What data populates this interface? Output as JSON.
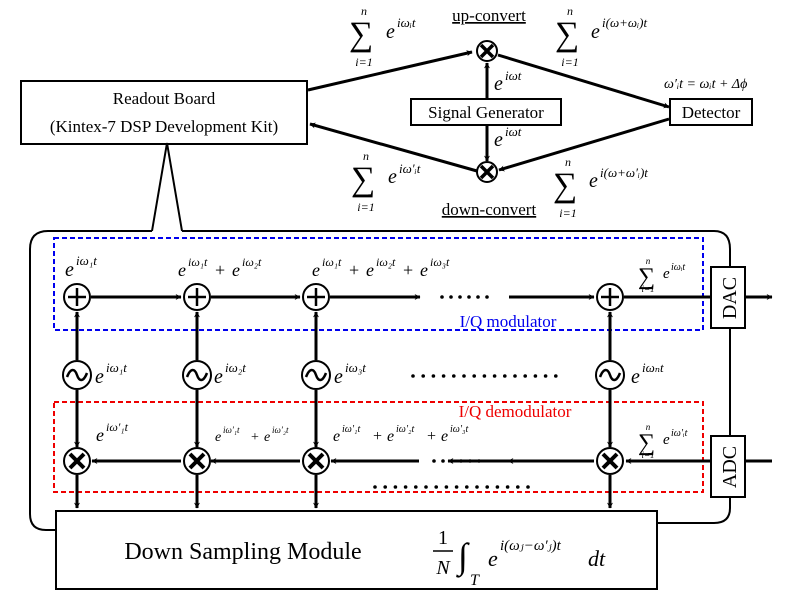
{
  "colors": {
    "line": "#000000",
    "modulator_border": "#0000ee",
    "demodulator_border": "#ee0000",
    "background": "#ffffff"
  },
  "readout_board": {
    "line1": "Readout Board",
    "line2": "(Kintex-7 DSP Development Kit)"
  },
  "signal_generator": {
    "label": "Signal Generator"
  },
  "detector": {
    "label": "Detector"
  },
  "up_convert": {
    "label": "up-convert",
    "input_sum": {
      "upper": "n",
      "lower": "i=1",
      "term": "e",
      "exp": "iωᵢt"
    },
    "carrier": {
      "base": "e",
      "exp": "iωt"
    },
    "output_sum": {
      "upper": "n",
      "lower": "i=1",
      "term": "e",
      "exp": "i(ω+ωᵢ)t"
    }
  },
  "down_convert": {
    "label": "down-convert",
    "input_sum": {
      "upper": "n",
      "lower": "i=1",
      "term": "e",
      "exp": "i(ω+ω′ᵢ)t"
    },
    "carrier": {
      "base": "e",
      "exp": "iωt"
    },
    "output_sum": {
      "upper": "n",
      "lower": "i=1",
      "term": "e",
      "exp": "iω′ᵢt"
    }
  },
  "phase_relation": "ω′ᵢt = ωᵢt + Δϕ",
  "modulator": {
    "label": "I/Q modulator",
    "adder_labels": [
      {
        "base": "e",
        "exp": "iω₁t"
      },
      {
        "text": "e^{iω₁t} + e^{iω₂t}",
        "parts": [
          {
            "base": "e",
            "exp": "iω₁t"
          },
          {
            "base": "e",
            "exp": "iω₂t"
          }
        ]
      },
      {
        "text": "e^{iω₁t} + e^{iω₂t} + e^{iω₃t}",
        "parts": [
          {
            "base": "e",
            "exp": "iω₁t"
          },
          {
            "base": "e",
            "exp": "iω₂t"
          },
          {
            "base": "e",
            "exp": "iω₃t"
          }
        ]
      }
    ],
    "output_sum": {
      "upper": "n",
      "lower": "i=1",
      "term": "e",
      "exp": "iωᵢt"
    },
    "ellipsis": "……"
  },
  "oscillators": [
    {
      "base": "e",
      "exp": "iω₁t"
    },
    {
      "base": "e",
      "exp": "iω₂t"
    },
    {
      "base": "e",
      "exp": "iω₃t"
    },
    {
      "base": "e",
      "exp": "iωₙt"
    }
  ],
  "demodulator": {
    "label": "I/Q demodulator",
    "mixer_labels": [
      {
        "parts": [
          {
            "base": "e",
            "exp": "iω′₁t"
          }
        ]
      },
      {
        "parts": [
          {
            "base": "e",
            "exp": "iω′₁t"
          },
          {
            "base": "e",
            "exp": "iω′₂t"
          }
        ]
      },
      {
        "parts": [
          {
            "base": "e",
            "exp": "iω′₁t"
          },
          {
            "base": "e",
            "exp": "iω′₂t"
          },
          {
            "base": "e",
            "exp": "iω′₃t"
          }
        ]
      }
    ],
    "input_sum": {
      "upper": "n",
      "lower": "i=1",
      "term": "e",
      "exp": "iω′ᵢt"
    }
  },
  "dac": {
    "label": "DAC"
  },
  "adc": {
    "label": "ADC"
  },
  "down_sampling": {
    "label": "Down Sampling Module",
    "formula": {
      "frac_num": "1",
      "frac_den": "N",
      "integral": "∫",
      "sub": "T",
      "base": "e",
      "exp": "i(ωⱼ−ω′ⱼ)t",
      "tail": "dt"
    }
  },
  "plus_glyph": "+"
}
